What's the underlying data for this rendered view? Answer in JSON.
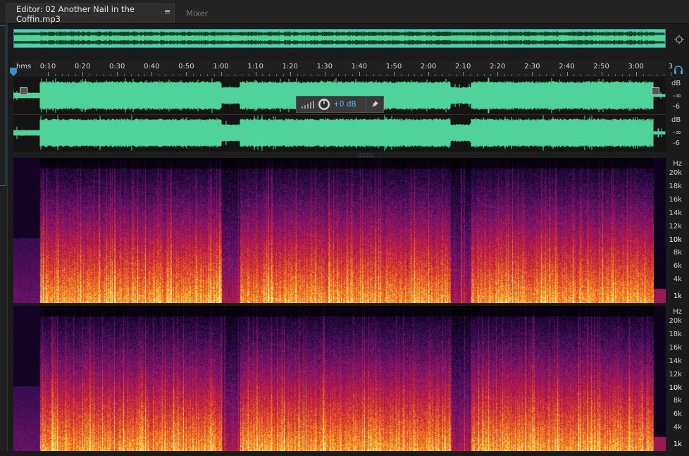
{
  "tabs": {
    "editor_label": "Editor: 02 Another Nail in the Coffin.mp3",
    "menu_glyph": "≡",
    "mixer_label": "Mixer"
  },
  "ruler": {
    "unit_label": "hms",
    "ticks": [
      "0:10",
      "0:20",
      "0:30",
      "0:40",
      "0:50",
      "1:00",
      "1:10",
      "1:20",
      "1:30",
      "1:40",
      "1:50",
      "2:00",
      "2:10",
      "2:20",
      "2:30",
      "2:40",
      "2:50",
      "3:00",
      "3"
    ]
  },
  "amplitude_scale": {
    "channel_1": [
      "dB",
      "-∞",
      "-6"
    ],
    "channel_2": [
      "dB",
      "-∞",
      "-6"
    ]
  },
  "clip_hud": {
    "volume_label": "+0 dB"
  },
  "frequency_scale": {
    "unit": "Hz",
    "labels": [
      "20k",
      "18k",
      "16k",
      "14k",
      "12k",
      "10k",
      "8k",
      "6k",
      "4k",
      "1k"
    ]
  },
  "icons": {
    "tab_menu": "panel-menu-icon",
    "zoom": "zoom-navigator-icon",
    "headphones": "headphones-icon",
    "playhead": "playhead-marker-icon",
    "hud_meter": "level-meter-icon",
    "hud_knob": "volume-knob-icon",
    "hud_pin": "pin-icon"
  },
  "colors": {
    "waveform": "#4fd39a",
    "selection": "#3d7fb0",
    "accent": "#5fb4ef"
  }
}
